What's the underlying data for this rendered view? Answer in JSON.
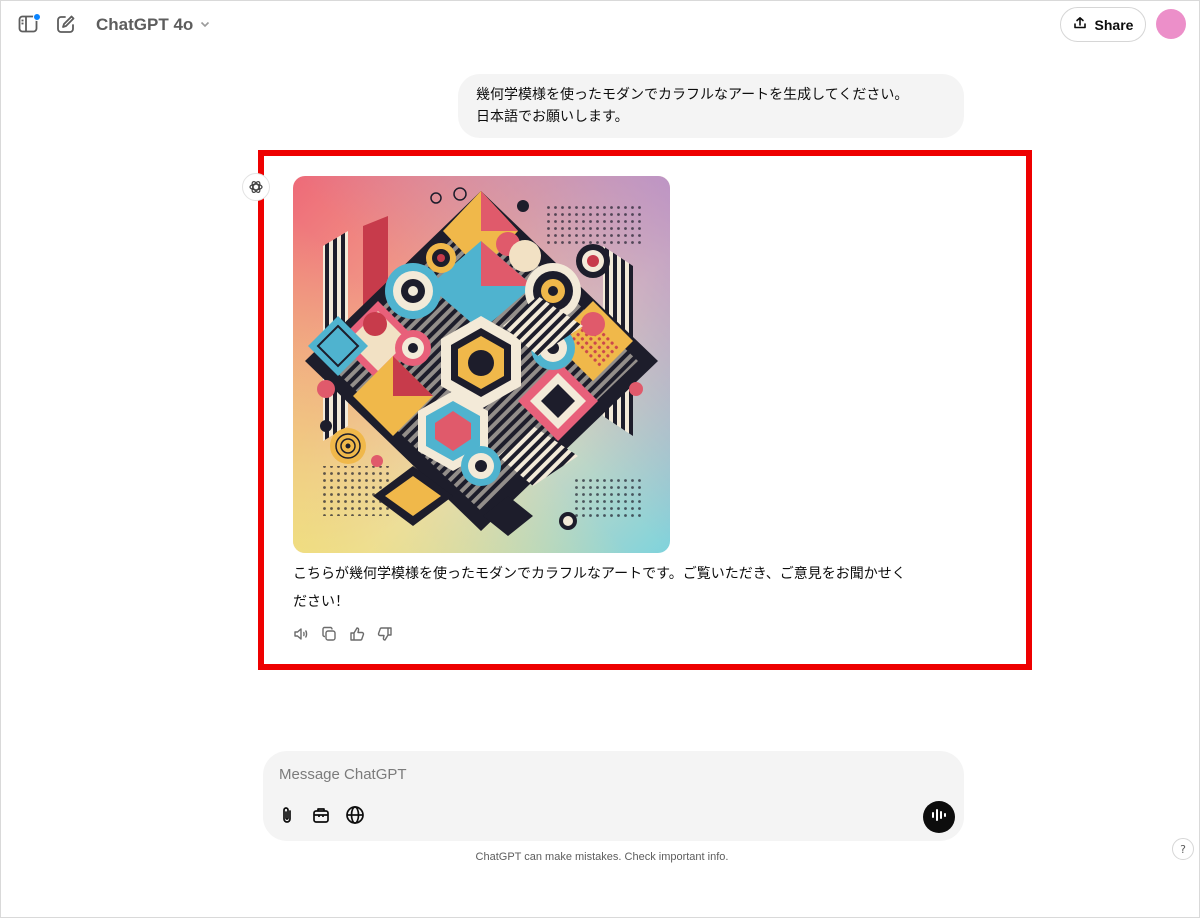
{
  "header": {
    "model_name": "ChatGPT 4o",
    "share_label": "Share"
  },
  "conversation": {
    "user_message": {
      "line1": "幾何学模様を使ったモダンでカラフルなアートを生成してください。",
      "line2": "日本語でお願いします。"
    },
    "assistant_message": {
      "line1": "こちらが幾何学模様を使ったモダンでカラフルなアートです。ご覧いただき、ご意見をお聞かせく",
      "line2": "ださい！"
    }
  },
  "composer": {
    "placeholder": "Message ChatGPT"
  },
  "disclaimer": "ChatGPT can make mistakes. Check important info.",
  "help_label": "?",
  "icons": {
    "sidebar": "sidebar-toggle-icon",
    "new_chat": "edit-icon",
    "share": "upload-icon",
    "assistant": "openai-logo-icon",
    "read_aloud": "speaker-icon",
    "copy": "copy-icon",
    "like": "thumbs-up-icon",
    "dislike": "thumbs-down-icon",
    "attach": "paperclip-icon",
    "tools": "briefcase-icon",
    "search": "globe-icon",
    "voice": "voice-wave-icon"
  },
  "colors": {
    "highlight": "#ee0000",
    "notification_dot": "#0a84ff",
    "avatar": "#ec8fc9",
    "bubble_bg": "#f4f4f4"
  }
}
